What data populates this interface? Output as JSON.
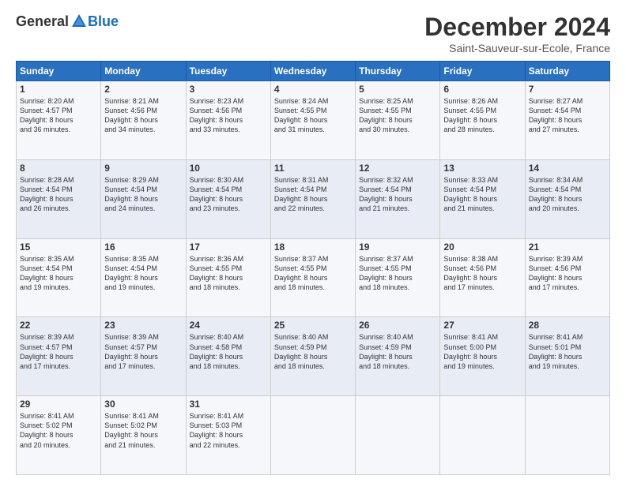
{
  "logo": {
    "general": "General",
    "blue": "Blue"
  },
  "header": {
    "title": "December 2024",
    "location": "Saint-Sauveur-sur-Ecole, France"
  },
  "days_of_week": [
    "Sunday",
    "Monday",
    "Tuesday",
    "Wednesday",
    "Thursday",
    "Friday",
    "Saturday"
  ],
  "weeks": [
    [
      {
        "day": "1",
        "sunrise": "8:20 AM",
        "sunset": "4:57 PM",
        "daylight": "8 hours and 36 minutes."
      },
      {
        "day": "2",
        "sunrise": "8:21 AM",
        "sunset": "4:56 PM",
        "daylight": "8 hours and 34 minutes."
      },
      {
        "day": "3",
        "sunrise": "8:23 AM",
        "sunset": "4:56 PM",
        "daylight": "8 hours and 33 minutes."
      },
      {
        "day": "4",
        "sunrise": "8:24 AM",
        "sunset": "4:55 PM",
        "daylight": "8 hours and 31 minutes."
      },
      {
        "day": "5",
        "sunrise": "8:25 AM",
        "sunset": "4:55 PM",
        "daylight": "8 hours and 30 minutes."
      },
      {
        "day": "6",
        "sunrise": "8:26 AM",
        "sunset": "4:55 PM",
        "daylight": "8 hours and 28 minutes."
      },
      {
        "day": "7",
        "sunrise": "8:27 AM",
        "sunset": "4:54 PM",
        "daylight": "8 hours and 27 minutes."
      }
    ],
    [
      {
        "day": "8",
        "sunrise": "8:28 AM",
        "sunset": "4:54 PM",
        "daylight": "8 hours and 26 minutes."
      },
      {
        "day": "9",
        "sunrise": "8:29 AM",
        "sunset": "4:54 PM",
        "daylight": "8 hours and 24 minutes."
      },
      {
        "day": "10",
        "sunrise": "8:30 AM",
        "sunset": "4:54 PM",
        "daylight": "8 hours and 23 minutes."
      },
      {
        "day": "11",
        "sunrise": "8:31 AM",
        "sunset": "4:54 PM",
        "daylight": "8 hours and 22 minutes."
      },
      {
        "day": "12",
        "sunrise": "8:32 AM",
        "sunset": "4:54 PM",
        "daylight": "8 hours and 21 minutes."
      },
      {
        "day": "13",
        "sunrise": "8:33 AM",
        "sunset": "4:54 PM",
        "daylight": "8 hours and 21 minutes."
      },
      {
        "day": "14",
        "sunrise": "8:34 AM",
        "sunset": "4:54 PM",
        "daylight": "8 hours and 20 minutes."
      }
    ],
    [
      {
        "day": "15",
        "sunrise": "8:35 AM",
        "sunset": "4:54 PM",
        "daylight": "8 hours and 19 minutes."
      },
      {
        "day": "16",
        "sunrise": "8:35 AM",
        "sunset": "4:54 PM",
        "daylight": "8 hours and 19 minutes."
      },
      {
        "day": "17",
        "sunrise": "8:36 AM",
        "sunset": "4:55 PM",
        "daylight": "8 hours and 18 minutes."
      },
      {
        "day": "18",
        "sunrise": "8:37 AM",
        "sunset": "4:55 PM",
        "daylight": "8 hours and 18 minutes."
      },
      {
        "day": "19",
        "sunrise": "8:37 AM",
        "sunset": "4:55 PM",
        "daylight": "8 hours and 18 minutes."
      },
      {
        "day": "20",
        "sunrise": "8:38 AM",
        "sunset": "4:56 PM",
        "daylight": "8 hours and 17 minutes."
      },
      {
        "day": "21",
        "sunrise": "8:39 AM",
        "sunset": "4:56 PM",
        "daylight": "8 hours and 17 minutes."
      }
    ],
    [
      {
        "day": "22",
        "sunrise": "8:39 AM",
        "sunset": "4:57 PM",
        "daylight": "8 hours and 17 minutes."
      },
      {
        "day": "23",
        "sunrise": "8:39 AM",
        "sunset": "4:57 PM",
        "daylight": "8 hours and 17 minutes."
      },
      {
        "day": "24",
        "sunrise": "8:40 AM",
        "sunset": "4:58 PM",
        "daylight": "8 hours and 18 minutes."
      },
      {
        "day": "25",
        "sunrise": "8:40 AM",
        "sunset": "4:59 PM",
        "daylight": "8 hours and 18 minutes."
      },
      {
        "day": "26",
        "sunrise": "8:40 AM",
        "sunset": "4:59 PM",
        "daylight": "8 hours and 18 minutes."
      },
      {
        "day": "27",
        "sunrise": "8:41 AM",
        "sunset": "5:00 PM",
        "daylight": "8 hours and 19 minutes."
      },
      {
        "day": "28",
        "sunrise": "8:41 AM",
        "sunset": "5:01 PM",
        "daylight": "8 hours and 19 minutes."
      }
    ],
    [
      {
        "day": "29",
        "sunrise": "8:41 AM",
        "sunset": "5:02 PM",
        "daylight": "8 hours and 20 minutes."
      },
      {
        "day": "30",
        "sunrise": "8:41 AM",
        "sunset": "5:02 PM",
        "daylight": "8 hours and 21 minutes."
      },
      {
        "day": "31",
        "sunrise": "8:41 AM",
        "sunset": "5:03 PM",
        "daylight": "8 hours and 22 minutes."
      },
      null,
      null,
      null,
      null
    ]
  ],
  "labels": {
    "sunrise": "Sunrise:",
    "sunset": "Sunset:",
    "daylight": "Daylight:"
  }
}
